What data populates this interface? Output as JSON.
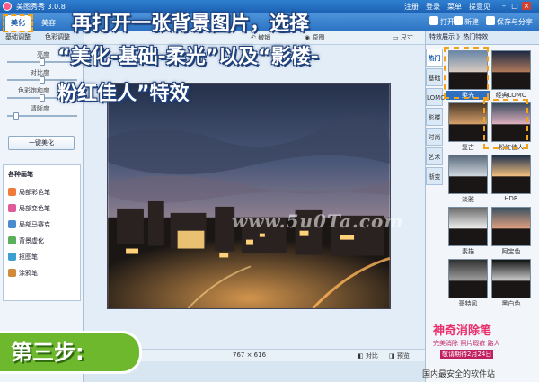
{
  "app": {
    "title": "美图秀秀 3.0.8",
    "menu": [
      "注册",
      "登录",
      "菜单",
      "提意见"
    ],
    "mode_tabs": [
      "美化",
      "美容"
    ],
    "toolbar_right": {
      "open": "打开",
      "new": "新建",
      "save": "保存与分享"
    }
  },
  "left_panel": {
    "subtabs": [
      "基础调整",
      "色彩调整"
    ],
    "sliders": [
      {
        "label": "亮度",
        "value": 0.5
      },
      {
        "label": "对比度",
        "value": 0.5
      },
      {
        "label": "色彩饱和度",
        "value": 0.5
      },
      {
        "label": "清晰度",
        "value": 0.1
      }
    ],
    "onekey": "一键美化",
    "brush_title": "各种画笔",
    "brushes": [
      "局部彩色笔",
      "局部变色笔",
      "局部马赛克",
      "背景虚化",
      "抠图笔",
      "涂鸦笔"
    ]
  },
  "canvas": {
    "tools": [
      "撤销",
      "原图",
      "尺寸"
    ],
    "dimensions": "767 × 616",
    "status_buttons": [
      "对比",
      "预览"
    ]
  },
  "right_panel": {
    "header": "特效展示 》热门特效",
    "categories": [
      "热门",
      "基础",
      "LOMO",
      "影楼",
      "时尚",
      "艺术",
      "渐变"
    ],
    "thumbnails": [
      {
        "label": "柔光",
        "selected": true
      },
      {
        "label": "经典LOMO",
        "selected": false
      },
      {
        "label": "复古",
        "selected": false
      },
      {
        "label": "粉红佳人",
        "selected": false
      },
      {
        "label": "淡雅",
        "selected": false
      },
      {
        "label": "HDR",
        "selected": false
      },
      {
        "label": "素描",
        "selected": false
      },
      {
        "label": "阿宝色",
        "selected": false
      },
      {
        "label": "哥特风",
        "selected": false
      },
      {
        "label": "黑白色",
        "selected": false
      }
    ]
  },
  "overlay": {
    "line1": "再打开一张背景图片，选择",
    "line2": "“美化-基础-柔光”以及“影楼-",
    "line3": "粉红佳人”特效",
    "step": "第三步:",
    "watermark": "www.5u0Ta.com",
    "ad_brand": "神奇消除笔",
    "ad_line1": "完美消除 照片瑕疵 路人",
    "ad_line2": "敬请期待2月24日",
    "footer": "国内最安全的软件站"
  },
  "colors": {
    "accent": "#2c74c4",
    "highlight": "#f4a21a",
    "step": "#6db82c"
  }
}
